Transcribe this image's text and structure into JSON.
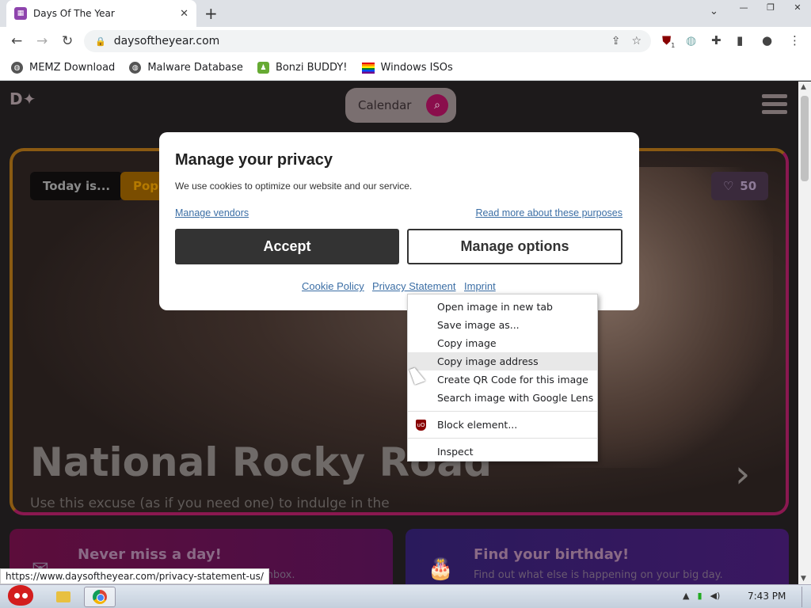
{
  "tab": {
    "title": "Days Of The Year",
    "close": "✕",
    "new_tab": "+"
  },
  "window_controls": {
    "minimize": "—",
    "maximize": "❐",
    "close": "✕"
  },
  "address_bar": {
    "url": "daysoftheyear.com"
  },
  "extension_badge": "1",
  "bookmarks": [
    {
      "label": "MEMZ Download"
    },
    {
      "label": "Malware Database"
    },
    {
      "label": "Bonzi BUDDY!"
    },
    {
      "label": "Windows ISOs"
    }
  ],
  "page": {
    "calendar_label": "Calendar",
    "chips": {
      "today": "Today is...",
      "popular": "Popular"
    },
    "likes": "50",
    "hero_title": "National Rocky Road",
    "hero_description": "Use this excuse (as if you need one) to indulge in the marshmallows, nuts, chocolate, and ice cream. That's right, you heard it, ice cream.",
    "cards": [
      {
        "title": "Never miss a day!",
        "subtitle": "Get the best days delivered to your inbox."
      },
      {
        "title": "Find your birthday!",
        "subtitle": "Find out what else is happening on your big day."
      }
    ]
  },
  "consent": {
    "title": "Manage your privacy",
    "description": "We use cookies to optimize our website and our service.",
    "manage_vendors": "Manage vendors",
    "read_more": "Read more about these purposes",
    "accept": "Accept",
    "manage_options": "Manage options",
    "footer_links": [
      "Cookie Policy",
      "Privacy Statement",
      "Imprint"
    ]
  },
  "context_menu": {
    "items": [
      "Open image in new tab",
      "Save image as...",
      "Copy image",
      "Copy image address",
      "Create QR Code for this image",
      "Search image with Google Lens",
      "Block element...",
      "Inspect"
    ],
    "highlighted_index": 3
  },
  "status_url": "https://www.daysoftheyear.com/privacy-statement-us/",
  "taskbar": {
    "clock": "7:43 PM"
  },
  "colors": {
    "accent": "#8a0e4c",
    "link": "#3b6ea5",
    "accept_bg": "#333333"
  }
}
